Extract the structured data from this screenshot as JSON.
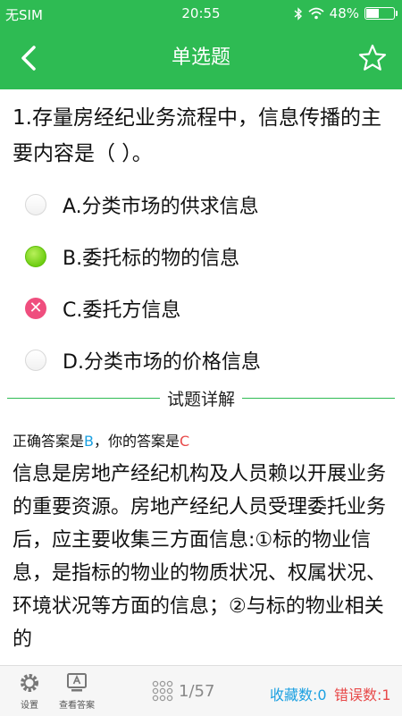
{
  "status": {
    "carrier": "无SIM",
    "time": "20:55",
    "battery": "48%",
    "battery_level": 0.48
  },
  "nav": {
    "title": "单选题"
  },
  "question": {
    "text": "1.存量房经纪业务流程中，信息传播的主要内容是（ ）。"
  },
  "options": [
    {
      "label": "A.分类市场的供求信息",
      "state": "empty"
    },
    {
      "label": "B.委托标的物的信息",
      "state": "correct"
    },
    {
      "label": "C.委托方信息",
      "state": "wrong"
    },
    {
      "label": "D.分类市场的价格信息",
      "state": "empty"
    }
  ],
  "section": {
    "title": "试题详解"
  },
  "answer": {
    "prefix": "正确答案是",
    "correct": "B",
    "middle": "，你的答案是",
    "yours": "C"
  },
  "analysis": {
    "text": "信息是房地产经纪机构及人员赖以开展业务的重要资源。房地产经纪人员受理委托业务后，应主要收集三方面信息:①标的物业信息，是指标的物业的物质状况、权属状况、环境状况等方面的信息；②与标的物业相关的"
  },
  "bottom": {
    "settings": "设置",
    "view_answer": "查看答案",
    "pager": "1/57",
    "favorites": "收藏数:0",
    "errors": "错误数:1"
  },
  "colors": {
    "accent": "#2ebb53",
    "blue": "#1ba0e1",
    "red": "#e84a4a"
  }
}
